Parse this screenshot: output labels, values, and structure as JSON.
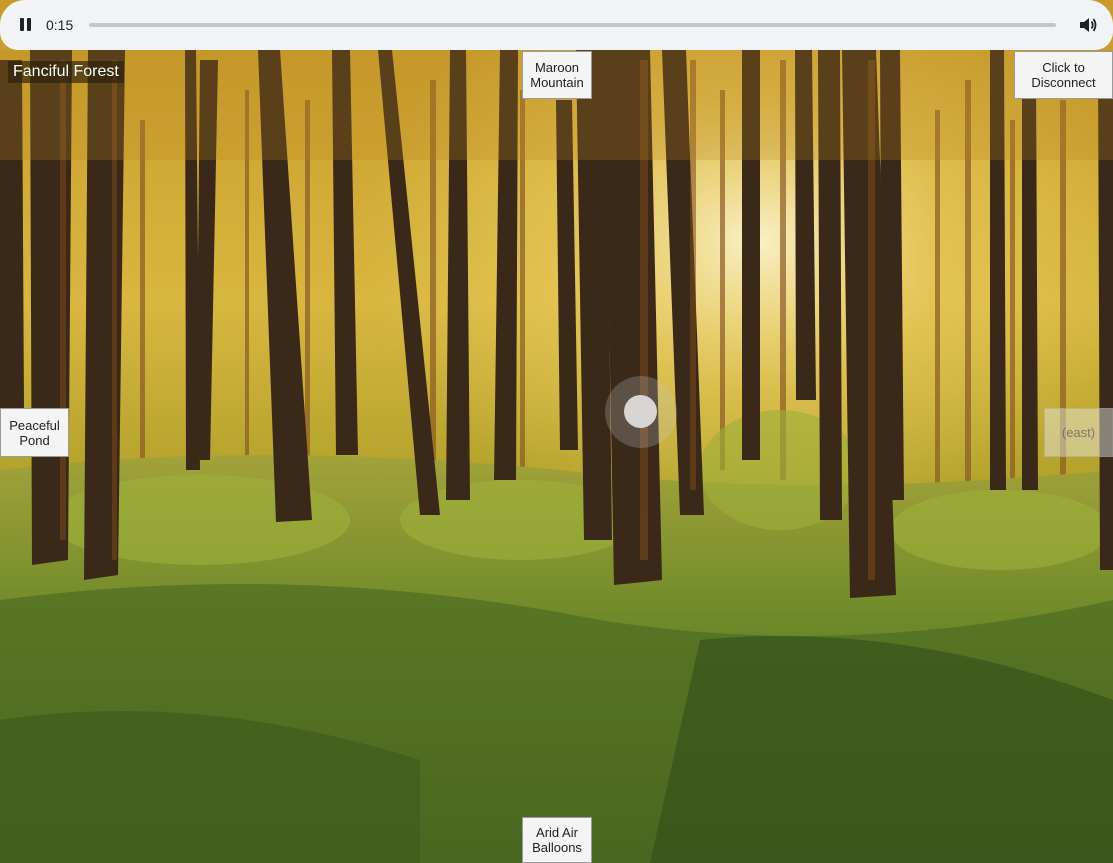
{
  "player": {
    "time": "0:15",
    "progress": 0.0,
    "pause_icon": "pause-icon",
    "volume_icon": "volume-icon"
  },
  "scene": {
    "title": "Fanciful Forest",
    "description_colors": {
      "sky": "#f6e8a4",
      "foliage": "#c9a32c",
      "grass": "#7f9b2c",
      "trunk": "#3a2918"
    }
  },
  "nav": {
    "north": "Maroon\nMountain",
    "west": "Peaceful\nPond",
    "east": "(east)",
    "south": "Arid Air\nBalloons",
    "disconnect": "Click to\nDisconnect"
  }
}
